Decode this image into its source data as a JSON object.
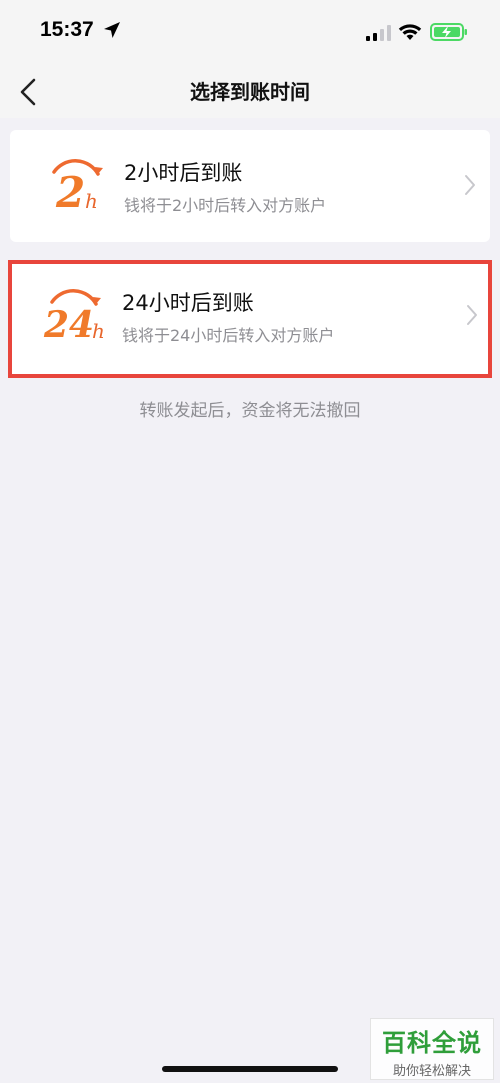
{
  "status_bar": {
    "time": "15:37",
    "icons": [
      "location-arrow-icon",
      "signal-icon",
      "wifi-icon",
      "battery-charging-icon"
    ],
    "battery_color": "#4cd964"
  },
  "nav": {
    "title": "选择到账时间",
    "back_icon": "chevron-left-icon"
  },
  "options": [
    {
      "logo_text": "2",
      "logo_sub": "h",
      "title": "2小时后到账",
      "desc": "钱将于2小时后转入对方账户",
      "highlighted": false
    },
    {
      "logo_text": "24",
      "logo_sub": "h",
      "title": "24小时后到账",
      "desc": "钱将于24小时后转入对方账户",
      "highlighted": true
    }
  ],
  "hint": "转账发起后，资金将无法撤回",
  "watermark": {
    "brand": "百科全说",
    "tagline": "助你轻松解决"
  },
  "colors": {
    "accent_orange": "#f07a2a",
    "highlight_red": "#e8453c",
    "background": "#f2f1f6"
  }
}
